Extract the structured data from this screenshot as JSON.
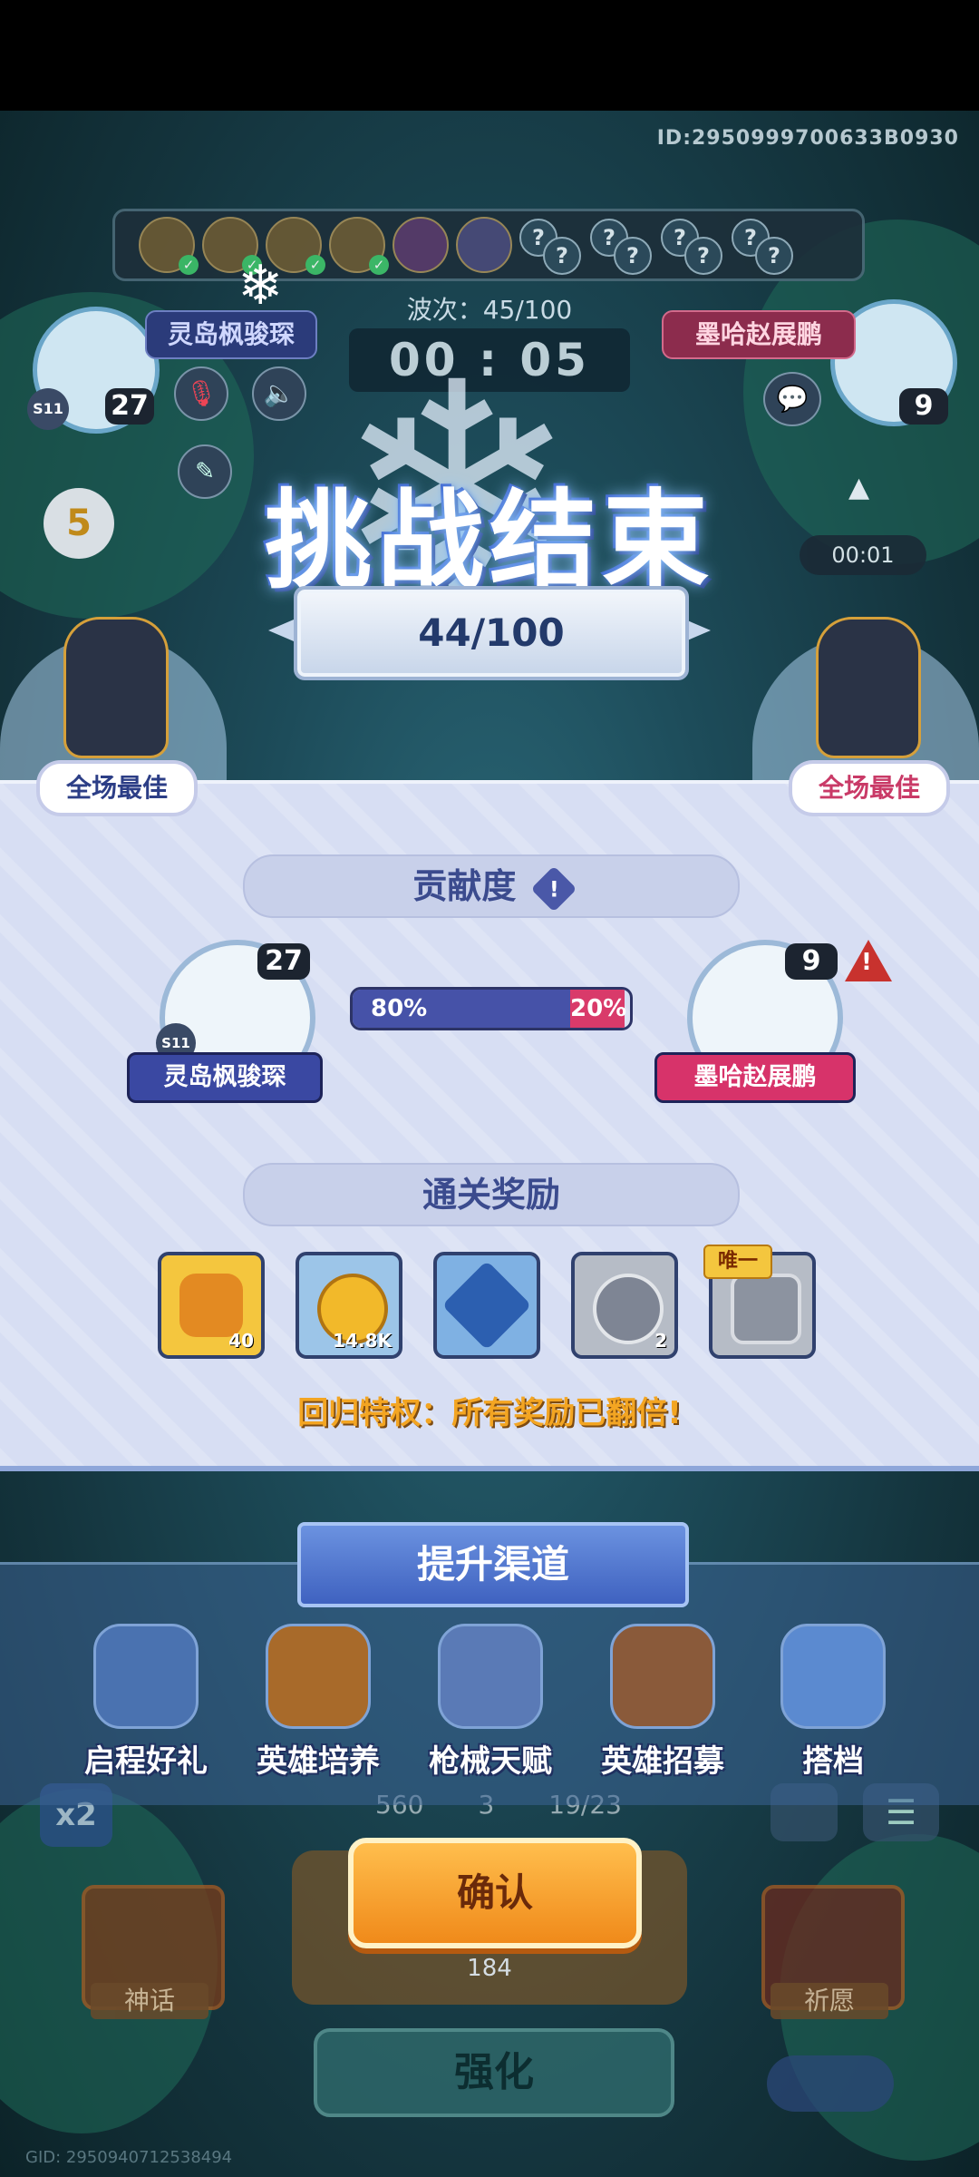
{
  "header": {
    "player_id": "ID:2950999700633B0930"
  },
  "game_hud": {
    "wave_label": "波次：45/100",
    "timer": "00 : 05",
    "small_timer": "00:01",
    "player1": {
      "name": "灵岛枫骏琛",
      "level": "27",
      "badge": "S11"
    },
    "player2": {
      "name": "墨哈赵展鹏",
      "level": "9"
    },
    "bubble_number": "5"
  },
  "result": {
    "title": "挑战结束",
    "score": "44/100",
    "best_left": "全场最佳",
    "best_right": "全场最佳"
  },
  "contribution": {
    "title": "贡献度",
    "left_percent": "80%",
    "right_percent": "20%",
    "left_share": 0.8,
    "player1": {
      "name": "灵岛枫骏琛",
      "level": "27",
      "badge": "S11"
    },
    "player2": {
      "name": "墨哈赵展鹏",
      "level": "9"
    }
  },
  "rewards": {
    "title": "通关奖励",
    "items": [
      {
        "icon": "key-icon",
        "count": "40",
        "color": "#f4c63e"
      },
      {
        "icon": "gold-coin-icon",
        "count": "14.8K",
        "color": "#9cc5e8"
      },
      {
        "icon": "crystal-icon",
        "count": "",
        "color": "#7fb1e3"
      },
      {
        "icon": "sword-medal-icon",
        "count": "2",
        "color": "#b6bcc6"
      },
      {
        "icon": "emblem-icon",
        "count": "",
        "tag": "唯一",
        "color": "#b6bcc6"
      }
    ],
    "return_text": "回归特权：所有奖励已翻倍!"
  },
  "upgrade": {
    "title": "提升渠道",
    "items": [
      {
        "label": "启程好礼",
        "icon": "gift-hero-icon"
      },
      {
        "label": "英雄培养",
        "icon": "hero-card-icon"
      },
      {
        "label": "枪械天赋",
        "icon": "gun-icon"
      },
      {
        "label": "英雄招募",
        "icon": "recruit-icon"
      },
      {
        "label": "搭档",
        "icon": "partner-icon"
      }
    ]
  },
  "bottom": {
    "confirm_label": "确认",
    "coins": "184",
    "enhance_label": "强化",
    "stat1": "560",
    "stat2": "3",
    "stat3": "19/23",
    "left_label": "神话",
    "right_label": "祈愿",
    "multiplier": "x2",
    "gid": "GID: 2950940712538494"
  }
}
